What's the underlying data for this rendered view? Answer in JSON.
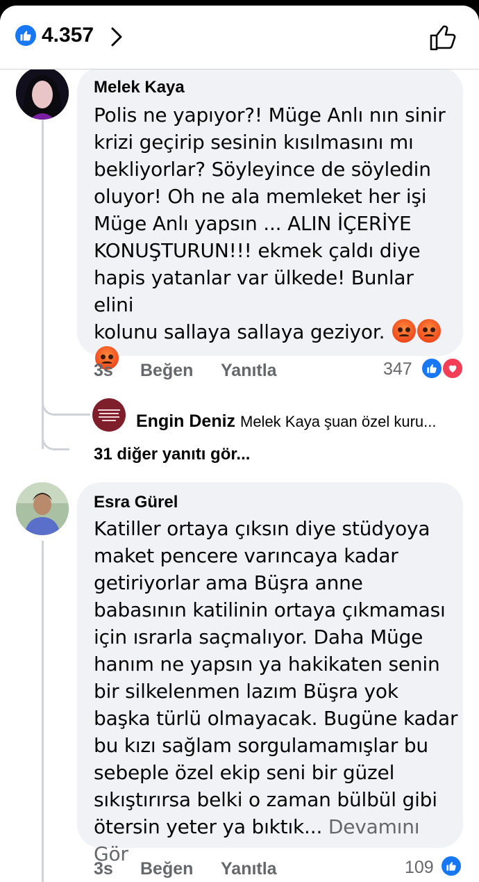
{
  "header": {
    "reaction_count": "4.357"
  },
  "comments": [
    {
      "author": "Melek Kaya",
      "lines": [
        "Polis ne yapıyor?! Müge Anlı nın sinir",
        "krizi geçirip sesinin kısılmasını mı",
        "bekliyorlar? Söyleyince de söyledin",
        "oluyor! Oh ne ala memleket her işi",
        "Müge Anlı yapsın ... ALIN İÇERİYE",
        "KONUŞTURUN!!! ekmek çaldı diye",
        "hapis yatanlar var ülkede! Bunlar elini",
        "kolunu sallaya sallaya geziyor."
      ],
      "time": "3s",
      "like_label": "Beğen",
      "reply_label": "Yanıtla",
      "reaction_count": "347",
      "reply": {
        "author": "Engin Deniz",
        "preview": "Melek Kaya  şuan özel kuru..."
      },
      "more_replies": "31 diğer yanıtı gör..."
    },
    {
      "author": "Esra Gürel",
      "lines": [
        "Katiller ortaya çıksın diye stüdyoya",
        "maket pencere varıncaya kadar",
        "getiriyorlar ama Büşra anne",
        "babasının katilinin ortaya çıkmaması",
        "için ısrarla saçmalıyor. Daha Müge",
        "hanım ne yapsın ya hakikaten senin",
        "bir silkelenmen lazım Büşra yok",
        "başka türlü olmayacak. Bugüne kadar",
        "bu kızı sağlam sorgulamamışlar bu",
        "sebeple özel ekip seni bir güzel",
        "sıkıştırırsa belki o zaman bülbül gibi",
        "ötersin yeter ya bıktık..."
      ],
      "see_more": "Devamını Gör",
      "time": "3s",
      "like_label": "Beğen",
      "reply_label": "Yanıtla",
      "reaction_count": "109"
    }
  ],
  "colors": {
    "accent": "#1877f2",
    "bubble": "#f0f2f5",
    "secondary_text": "#65676b",
    "love": "#f33e58"
  }
}
